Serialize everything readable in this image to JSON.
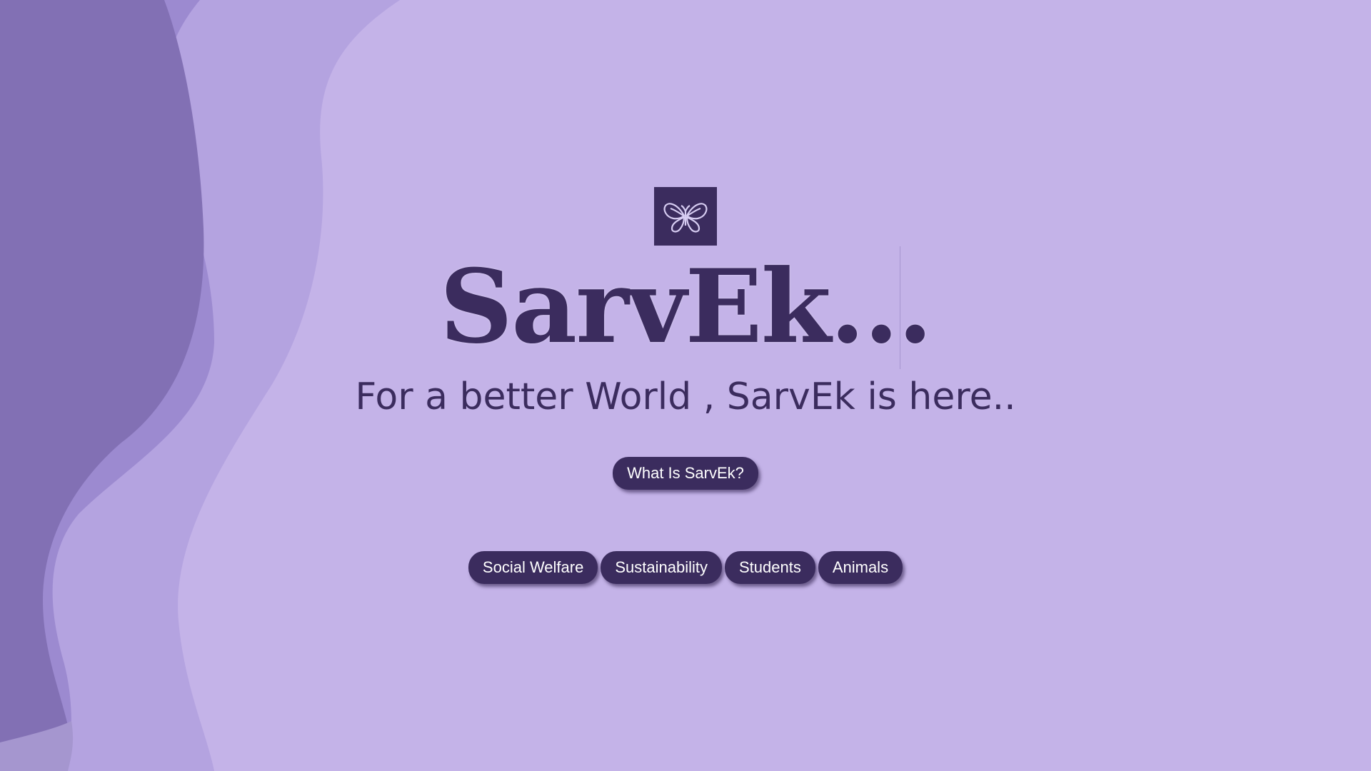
{
  "brand": {
    "name": "SarvEk...",
    "tagline": "For a better World , SarvEk is here..",
    "logo_icon": "butterfly-icon"
  },
  "cta": {
    "label": "What Is SarvEk?"
  },
  "categories": [
    {
      "label": "Social Welfare"
    },
    {
      "label": "Sustainability"
    },
    {
      "label": "Students"
    },
    {
      "label": "Animals"
    }
  ],
  "colors": {
    "background": "#c4b3e8",
    "primary": "#3b2c5e",
    "wave_dark": "#8270b4",
    "wave_mid": "#9c8ad0",
    "wave_light": "#b4a3e0",
    "button_text": "#ffffff"
  }
}
